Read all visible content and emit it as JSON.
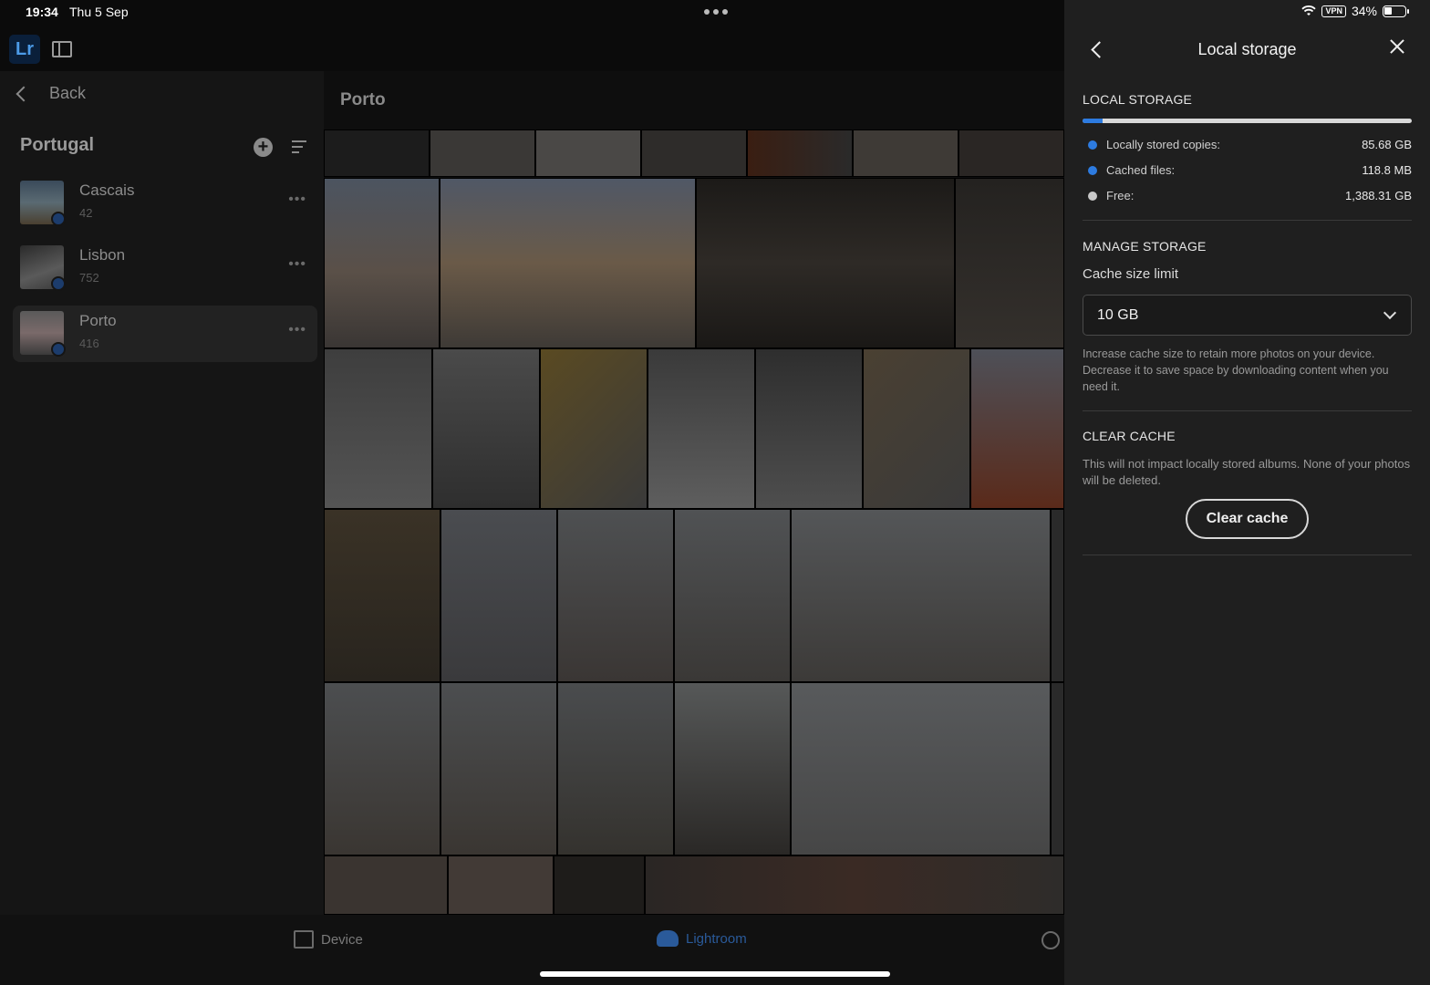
{
  "status_bar": {
    "time": "19:34",
    "date": "Thu 5 Sep",
    "vpn": "VPN",
    "battery": "34%"
  },
  "app": {
    "logo": "Lr"
  },
  "sidebar": {
    "back_label": "Back",
    "folder_title": "Portugal",
    "albums": [
      {
        "name": "Cascais",
        "count": "42"
      },
      {
        "name": "Lisbon",
        "count": "752"
      },
      {
        "name": "Porto",
        "count": "416"
      }
    ],
    "more": "•••"
  },
  "grid": {
    "title": "Porto"
  },
  "bottom_tabs": {
    "device": "Device",
    "lightroom": "Lightroom"
  },
  "panel": {
    "title": "Local storage",
    "local_storage": {
      "heading": "LOCAL STORAGE",
      "usage_fraction": 0.06,
      "rows": [
        {
          "label": "Locally stored copies:",
          "value": "85.68 GB",
          "color": "#2d7be0"
        },
        {
          "label": "Cached files:",
          "value": "118.8 MB",
          "color": "#2d7be0"
        },
        {
          "label": "Free:",
          "value": "1,388.31 GB",
          "color": "#c8c8c8"
        }
      ]
    },
    "manage_storage": {
      "heading": "MANAGE STORAGE",
      "cache_label": "Cache size limit",
      "cache_value": "10 GB",
      "help": "Increase cache size to retain more photos on your device. Decrease it to save space by downloading content when you need it."
    },
    "clear_cache": {
      "heading": "CLEAR CACHE",
      "help": "This will not impact locally stored albums. None of your photos will be deleted.",
      "button": "Clear cache"
    }
  }
}
